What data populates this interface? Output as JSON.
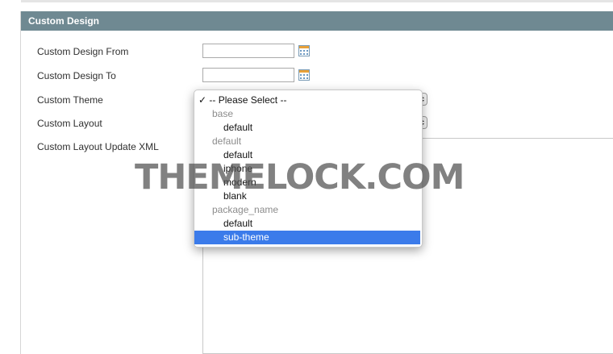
{
  "section": {
    "title": "Custom Design"
  },
  "fields": {
    "design_from": {
      "label": "Custom Design From",
      "value": ""
    },
    "design_to": {
      "label": "Custom Design To",
      "value": ""
    },
    "theme": {
      "label": "Custom Theme"
    },
    "layout": {
      "label": "Custom Layout"
    },
    "layout_xml": {
      "label": "Custom Layout Update XML"
    }
  },
  "theme_dropdown": {
    "checked_option": "-- Please Select --",
    "check_mark": "✓",
    "groups": [
      {
        "label": "base",
        "options": [
          "default"
        ]
      },
      {
        "label": "default",
        "options": [
          "default",
          "iphone",
          "modern",
          "blank"
        ]
      },
      {
        "label": "package_name",
        "options": [
          "default",
          "sub-theme"
        ]
      }
    ],
    "highlighted": "sub-theme"
  },
  "watermark": "THEMELOCK.COM",
  "colors": {
    "header_bg": "#6f8992",
    "highlight": "#3b7bea"
  },
  "icons": {
    "calendar": "calendar-icon",
    "select_arrows": "updown-arrows-icon"
  }
}
